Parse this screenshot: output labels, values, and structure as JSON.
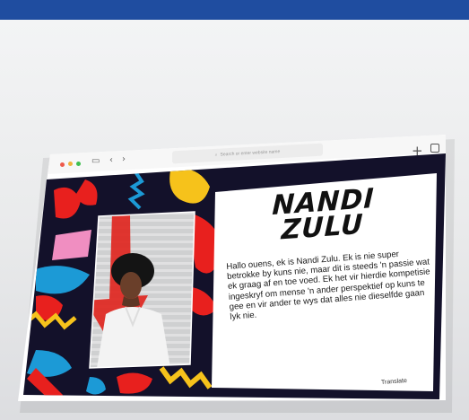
{
  "browser": {
    "traffic_lights": [
      "#ee5a4b",
      "#f0b23b",
      "#3fbf4f"
    ],
    "url_placeholder": "Search or enter website name",
    "new_tab_symbol": "+"
  },
  "page": {
    "title_line1": "NANDI",
    "title_line2": "ZULU",
    "bio": "Hallo ouens, ek is Nandi Zulu. Ek is nie super betrokke by kuns nie, maar dit is steeds 'n passie wat ek graag af en toe voed. Ek het vir hierdie kompetisie ingeskryf om mense 'n ander perspektief op kuns te gee en vir ander te wys dat alles nie dieselfde gaan lyk nie.",
    "translate_link": "Translate"
  },
  "colors": {
    "frame_dark": "#13112a",
    "accent_red": "#e8201e",
    "accent_yellow": "#f6c21b",
    "accent_blue": "#1c9ad6",
    "accent_pink": "#f08ec1",
    "accent_navy": "#1f4da0"
  }
}
